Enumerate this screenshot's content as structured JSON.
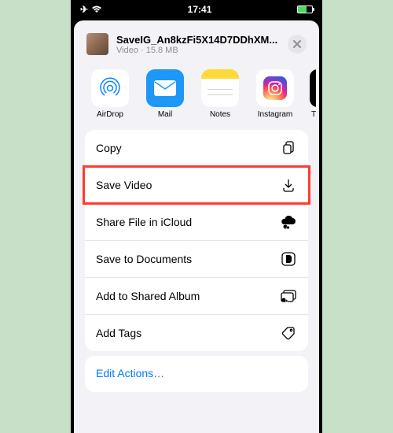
{
  "status": {
    "time": "17:41"
  },
  "file": {
    "name": "SaveIG_An8kzFi5X14D7DDhXM...",
    "meta": "Video · 15.8 MB"
  },
  "apps": {
    "airdrop": "AirDrop",
    "mail": "Mail",
    "notes": "Notes",
    "instagram": "Instagram",
    "tiktok": "T"
  },
  "actions": {
    "copy": "Copy",
    "save_video": "Save Video",
    "share_icloud": "Share File in iCloud",
    "save_documents": "Save to Documents",
    "add_shared_album": "Add to Shared Album",
    "add_tags": "Add Tags"
  },
  "edit": "Edit Actions…"
}
